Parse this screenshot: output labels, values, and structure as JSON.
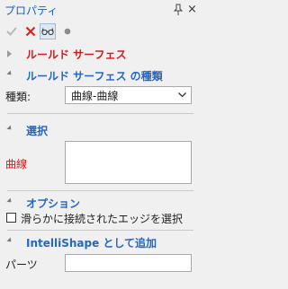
{
  "panel": {
    "title": "プロパティ"
  },
  "toolbar": {
    "ok_icon": "check-icon",
    "cancel_icon": "cancel-x-icon",
    "preview_icon": "glasses-icon",
    "dot_icon": "dot-icon"
  },
  "sections": {
    "ruled_surface": {
      "title": "ルールド サーフェス"
    },
    "type": {
      "title": "ルールド サーフェス の種類",
      "label": "種類:",
      "value": "曲線-曲線"
    },
    "selection": {
      "title": "選択",
      "label": "曲線",
      "items": []
    },
    "options": {
      "title": "オプション",
      "checkbox_label": "滑らかに接続されたエッジを選択",
      "checked": false
    },
    "intellishape": {
      "title": "IntelliShape として追加",
      "label": "パーツ",
      "value": ""
    }
  },
  "colors": {
    "accent": "#2566c0",
    "required": "#d01c1c",
    "background": "#f0f0f0"
  }
}
